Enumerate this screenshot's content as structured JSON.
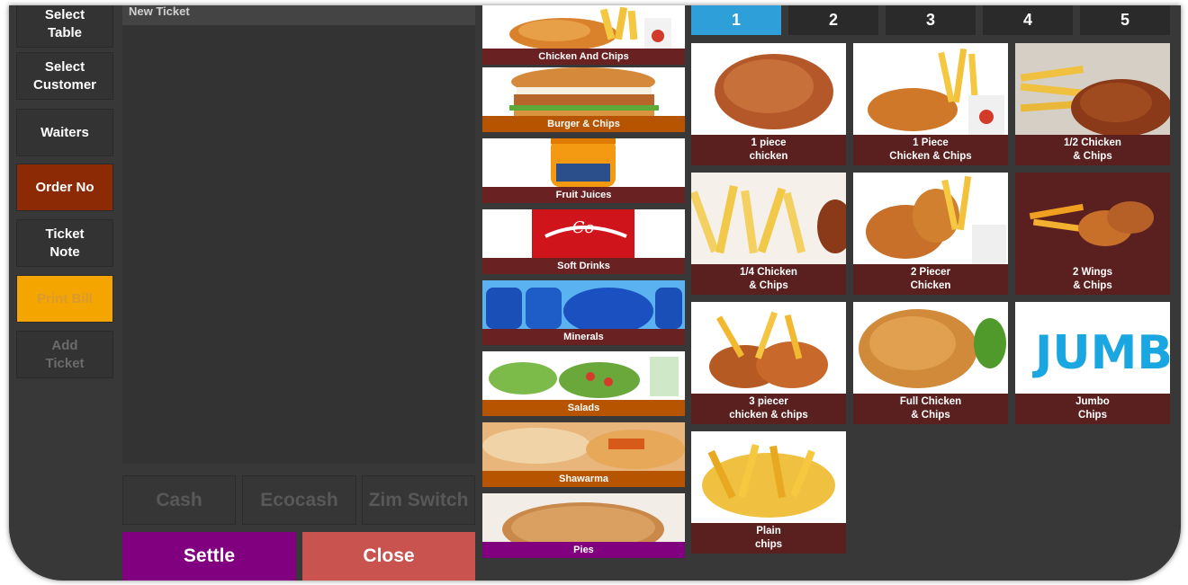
{
  "sidebar": {
    "items": [
      {
        "label": "Select\nTable"
      },
      {
        "label": "Select\nCustomer"
      },
      {
        "label": "Waiters"
      },
      {
        "label": "Order No"
      },
      {
        "label": "Ticket\nNote"
      },
      {
        "label": "Print Bill"
      },
      {
        "label": "Add\nTicket"
      }
    ]
  },
  "ticket": {
    "title": "New Ticket"
  },
  "payments": {
    "cash": "Cash",
    "ecocash": "Ecocash",
    "zimswitch": "Zim Switch"
  },
  "actions": {
    "settle": "Settle",
    "close": "Close"
  },
  "categories": [
    {
      "label": "Chicken And Chips"
    },
    {
      "label": "Burger & Chips"
    },
    {
      "label": "Fruit Juices"
    },
    {
      "label": "Soft Drinks"
    },
    {
      "label": "Minerals"
    },
    {
      "label": "Salads"
    },
    {
      "label": "Shawarma"
    },
    {
      "label": "Pies"
    }
  ],
  "pages": [
    "1",
    "2",
    "3",
    "4",
    "5"
  ],
  "products": [
    {
      "label": "1 piece\nchicken"
    },
    {
      "label": "1 Piece\nChicken & Chips"
    },
    {
      "label": "1/2 Chicken\n& Chips"
    },
    {
      "label": "1/4 Chicken\n& Chips"
    },
    {
      "label": "2 Piecer\nChicken"
    },
    {
      "label": "2 Wings\n& Chips"
    },
    {
      "label": "3 piecer\nchicken & chips"
    },
    {
      "label": "Full Chicken\n& Chips"
    },
    {
      "label": "Jumbo\nChips"
    },
    {
      "label": "Plain\nchips"
    }
  ],
  "jumbo_logo": "JUMBO",
  "colors": {
    "background": "#383838",
    "active_tab": "#2e9fd8",
    "order_no": "#8b2a05",
    "print_bill": "#f5a500",
    "settle": "#800080",
    "close": "#c9534f",
    "product_label": "#5a2020"
  }
}
